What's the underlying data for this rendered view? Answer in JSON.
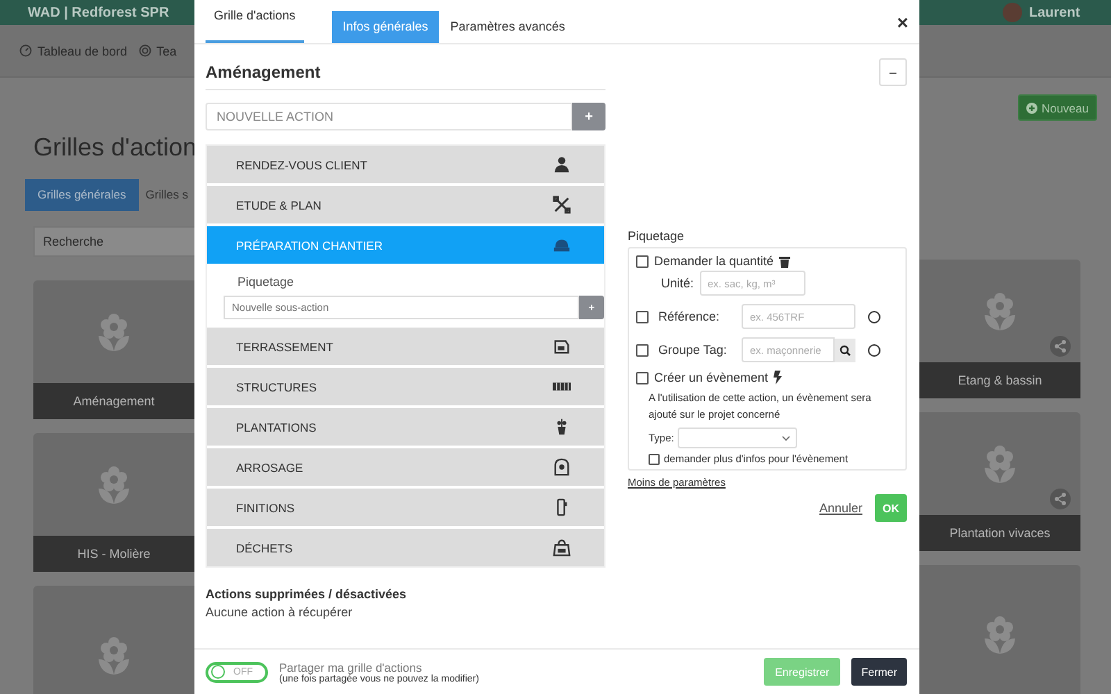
{
  "background": {
    "brand": "WAD | Redforest SPR",
    "user": "Laurent",
    "nav": [
      {
        "label": "Tableau de bord"
      },
      {
        "label": "Tea"
      }
    ],
    "new_button": "Nouveau",
    "heading": "Grilles d'action",
    "tabs": [
      {
        "label": "Grilles générales",
        "selected": true
      },
      {
        "label": "Grilles s",
        "selected": false
      }
    ],
    "search": {
      "placeholder": "Recherche"
    },
    "cards_left": [
      {
        "title": "Aménagement"
      },
      {
        "title": "HIS - Molière"
      }
    ],
    "cards_right": [
      {
        "title": "Etang & bassin",
        "shared": true
      },
      {
        "title": "Plantation vivaces",
        "shared": true
      },
      {
        "shared": false
      }
    ]
  },
  "modal": {
    "title_tab": "Grille d'actions",
    "tabs": [
      {
        "label": "Infos générales",
        "selected": true
      },
      {
        "label": "Paramètres avancés",
        "selected": false
      }
    ],
    "close": "×",
    "grid_name": "Aménagement",
    "collapse_button": "–",
    "new_action": {
      "placeholder": "NOUVELLE ACTION",
      "button": "+"
    },
    "sub_input": {
      "placeholder": "Nouvelle sous-action",
      "button": "+"
    },
    "actions": [
      {
        "label": "RENDEZ-VOUS CLIENT",
        "selected": false
      },
      {
        "label": "ETUDE & PLAN",
        "selected": false
      },
      {
        "label": "PRÉPARATION CHANTIER",
        "selected": true,
        "children": [
          {
            "label": "Piquetage"
          }
        ]
      },
      {
        "label": "TERRASSEMENT",
        "selected": false
      },
      {
        "label": "STRUCTURES",
        "selected": false
      },
      {
        "label": "PLANTATIONS",
        "selected": false
      },
      {
        "label": "ARROSAGE",
        "selected": false
      },
      {
        "label": "FINITIONS",
        "selected": false
      },
      {
        "label": "DÉCHETS",
        "selected": false
      }
    ],
    "settings": {
      "title": "Piquetage",
      "quantity": {
        "label": "Demander la quantité",
        "checked": false,
        "unit_label": "Unité:",
        "unit_placeholder": "ex. sac, kg, m³"
      },
      "reference": {
        "label": "Référence:",
        "checked": false,
        "placeholder": "ex. 456TRF"
      },
      "tag_group": {
        "label": "Groupe Tag:",
        "checked": false,
        "placeholder": "ex. maçonnerie"
      },
      "event": {
        "label": "Créer un évènement",
        "checked": false,
        "note": "A l'utilisation de cette action, un évènement sera ajouté sur le projet concerné",
        "type_label": "Type:",
        "more_info": {
          "label": "demander plus d'infos pour l'évènement",
          "checked": false
        }
      }
    },
    "less_link": "Moins de paramètres",
    "cancel": "Annuler",
    "ok": "OK",
    "deleted": {
      "title": "Actions supprimées / désactivées",
      "text": "Aucune action à récupérer"
    },
    "footer": {
      "share_toggle": {
        "on": false,
        "label": "OFF"
      },
      "share_label": "Partager ma grille d'actions",
      "share_note": "(une fois partagée vous ne pouvez la modifier)",
      "save": "Enregistrer",
      "close": "Fermer"
    }
  }
}
